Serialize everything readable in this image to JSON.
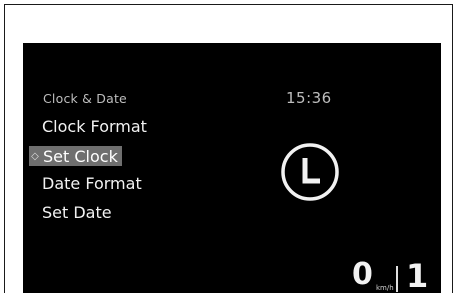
{
  "menu": {
    "header": "Clock & Date",
    "items": [
      {
        "label": "Clock Format"
      },
      {
        "label": "Set Clock",
        "selected": true
      },
      {
        "label": "Date Format"
      },
      {
        "label": "Set Date"
      }
    ],
    "selected_marker_icon": "selection-arrow-icon"
  },
  "status": {
    "time": "15:36",
    "speed": "0",
    "speed_unit": "km/h",
    "gear": "1"
  },
  "icons": {
    "clock": "clock-icon"
  },
  "colors": {
    "screen_background": "#000000",
    "selection_highlight": "#6f6f6f",
    "text": "#f2f2f2"
  }
}
